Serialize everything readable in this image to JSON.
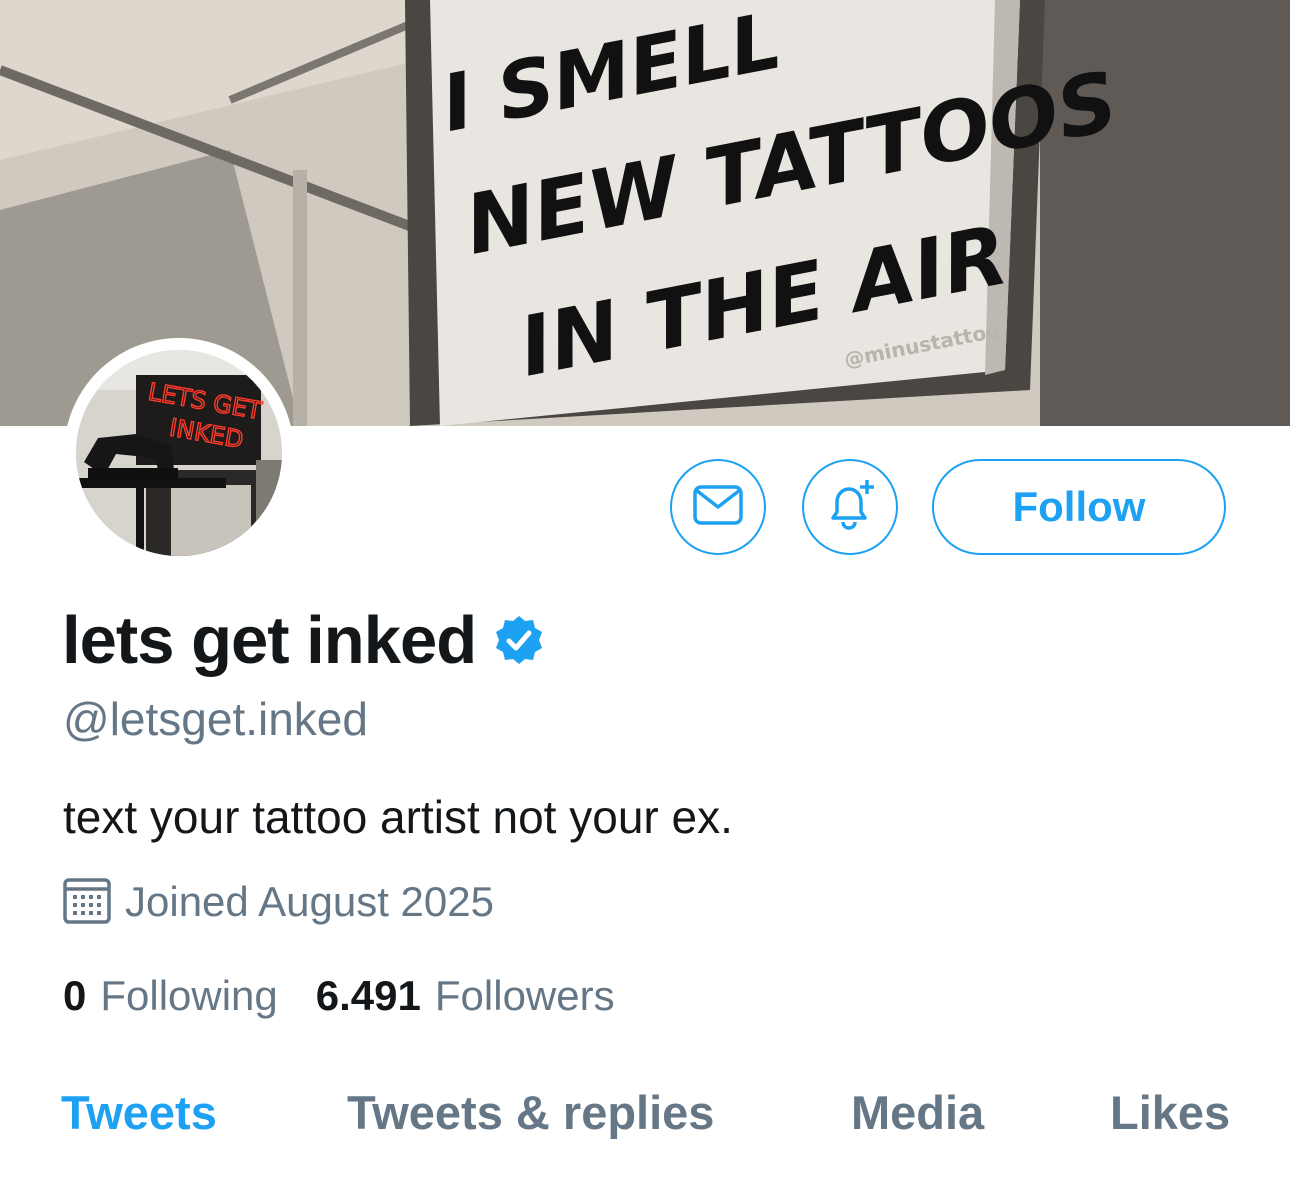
{
  "banner": {
    "sign_lines": [
      "I SMELL",
      "NEW TATTOOS",
      "IN THE AIR"
    ],
    "watermark": "@minustattoo"
  },
  "avatar": {
    "neon_lines": [
      "LETS GET",
      "INKED"
    ]
  },
  "actions": {
    "message_icon": "envelope-icon",
    "notify_icon": "bell-plus-icon",
    "follow_label": "Follow"
  },
  "profile": {
    "name": "lets get inked",
    "verified_icon": "verified-badge-icon",
    "handle": "@letsget.inked",
    "bio": "text your tattoo artist not your ex.",
    "joined_icon": "calendar-icon",
    "joined": "Joined August 2025",
    "following_count": "0",
    "following_label": "Following",
    "followers_count": "6.491",
    "followers_label": "Followers"
  },
  "tabs": [
    {
      "label": "Tweets",
      "active": true
    },
    {
      "label": "Tweets & replies",
      "active": false
    },
    {
      "label": "Media",
      "active": false
    },
    {
      "label": "Likes",
      "active": false
    }
  ],
  "colors": {
    "accent": "#1da1f2",
    "text_primary": "#14171a",
    "text_secondary": "#657786"
  }
}
